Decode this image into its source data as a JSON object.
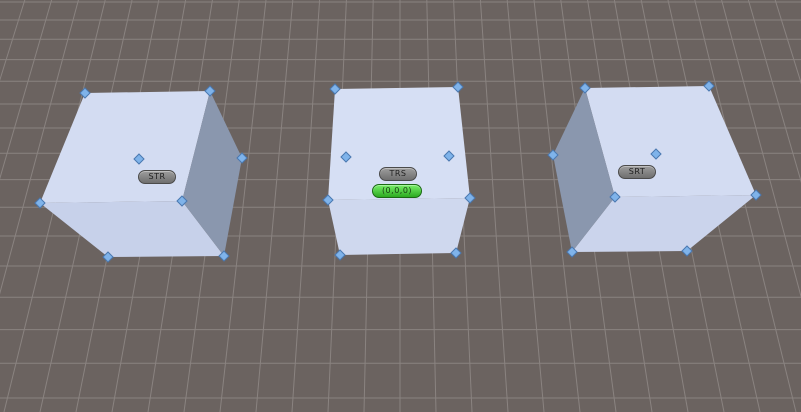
{
  "scene": {
    "background_color": "#6b6360",
    "grid_color": "#8a8380",
    "objects": [
      {
        "name": "cube-str",
        "label": "STR",
        "handle_count": 8
      },
      {
        "name": "cube-trs",
        "label": "TRS",
        "position_readout": "(0,0,0)",
        "handle_count": 8
      },
      {
        "name": "cube-srt",
        "label": "SRT",
        "handle_count": 8
      }
    ],
    "handle_color": "#7fb3ea"
  }
}
